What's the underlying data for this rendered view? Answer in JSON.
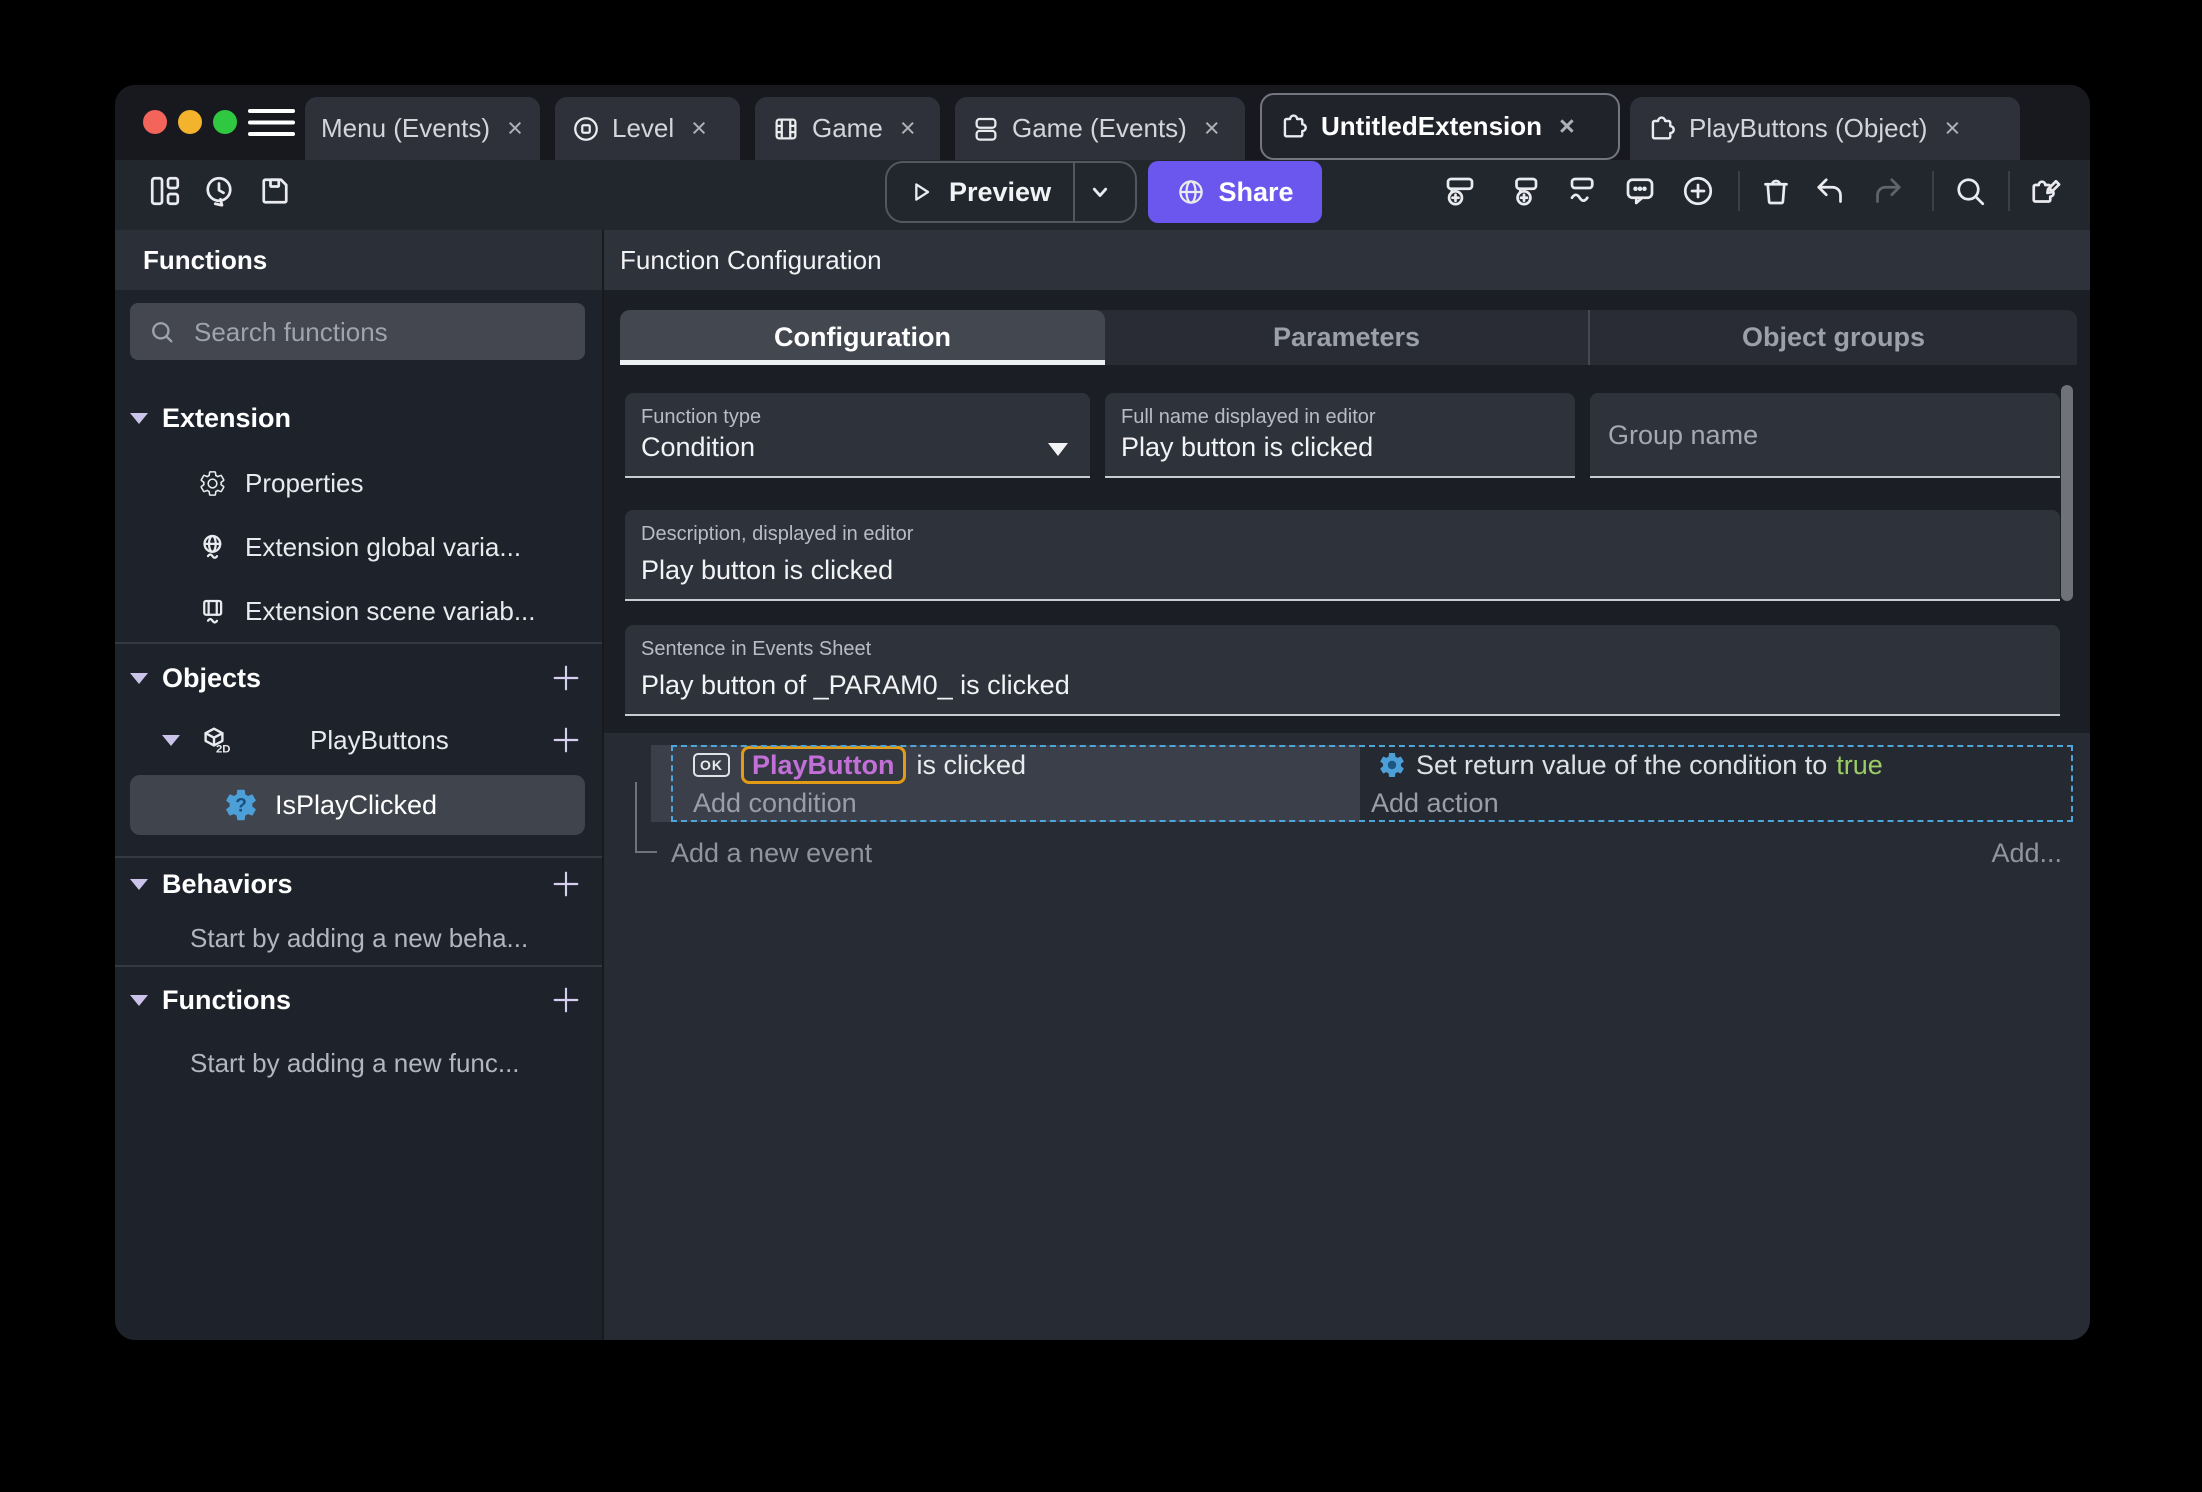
{
  "titlebar": {
    "close_glyph": "×",
    "tabs": [
      {
        "label": "Menu (Events)"
      },
      {
        "label": "Level"
      },
      {
        "label": "Game"
      },
      {
        "label": "Game (Events)"
      },
      {
        "label": "UntitledExtension"
      },
      {
        "label": "PlayButtons (Object)"
      }
    ]
  },
  "toolbar": {
    "preview_label": "Preview",
    "share_label": "Share"
  },
  "sidebar": {
    "title": "Functions",
    "search_placeholder": "Search functions",
    "extension": {
      "label": "Extension",
      "items": [
        {
          "label": "Properties"
        },
        {
          "label": "Extension global varia..."
        },
        {
          "label": "Extension scene variab..."
        }
      ]
    },
    "objects": {
      "label": "Objects",
      "object_label": "PlayButtons",
      "object_badge": "2D",
      "function_label": "IsPlayClicked",
      "function_badge": "?"
    },
    "behaviors": {
      "label": "Behaviors",
      "empty_label": "Start by adding a new beha..."
    },
    "functions": {
      "label": "Functions",
      "empty_label": "Start by adding a new func..."
    }
  },
  "main": {
    "title": "Function Configuration",
    "tabs": [
      {
        "label": "Configuration"
      },
      {
        "label": "Parameters"
      },
      {
        "label": "Object groups"
      }
    ],
    "form": {
      "function_type": {
        "label": "Function type",
        "value": "Condition"
      },
      "full_name": {
        "label": "Full name displayed in editor",
        "value": "Play button is clicked"
      },
      "group_name": {
        "placeholder": "Group name"
      },
      "description": {
        "label": "Description, displayed in editor",
        "value": "Play button is clicked"
      },
      "sentence": {
        "label": "Sentence in Events Sheet",
        "value": "Play button of _PARAM0_ is clicked"
      }
    },
    "events": {
      "condition": {
        "ok_badge": "OK",
        "object_name": "PlayButton",
        "suffix": "is clicked",
        "add_label": "Add condition"
      },
      "action": {
        "text": "Set return value of the condition to",
        "value": "true",
        "add_label": "Add action"
      },
      "add_event_label": "Add a new event",
      "add_more_label": "Add..."
    }
  },
  "colors": {
    "accent_purple": "#6b57ee",
    "selection_dashed_blue": "#4fa5da",
    "object_chip_text": "#c26fd8",
    "object_chip_border": "#e29b16",
    "boolean_true_green": "#9ccc65",
    "traffic_red": "#f3645b",
    "traffic_yellow": "#f3b32c",
    "traffic_green": "#2fc840"
  }
}
